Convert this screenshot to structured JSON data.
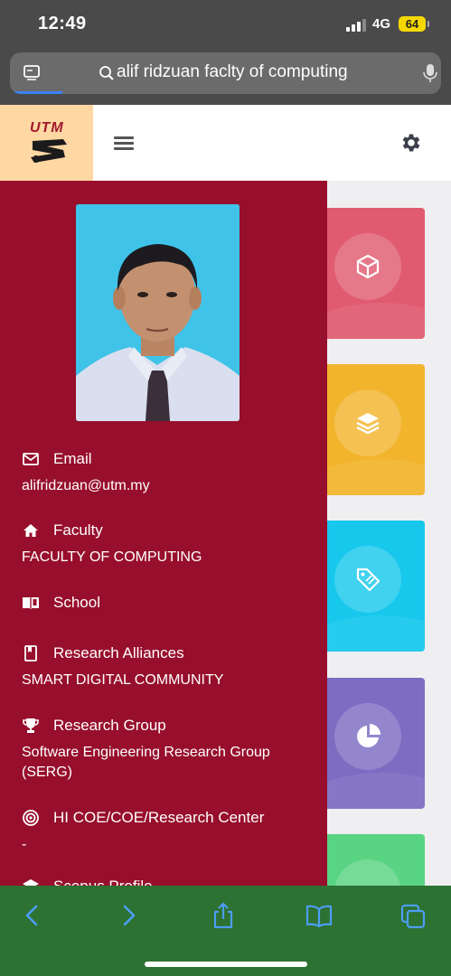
{
  "status_bar": {
    "time": "12:49",
    "network": "4G",
    "battery": "64"
  },
  "url_bar": {
    "text": "alif ridzuan faclty of computing"
  },
  "header": {
    "logo_text": "UTM"
  },
  "profile": {
    "items": [
      {
        "label": "Email",
        "value": "alifridzuan@utm.my",
        "icon": "mail-icon"
      },
      {
        "label": "Faculty",
        "value": "FACULTY OF COMPUTING",
        "icon": "home-icon"
      },
      {
        "label": "School",
        "value": "",
        "icon": "book-icon"
      },
      {
        "label": "Research Alliances",
        "value": "SMART DIGITAL COMMUNITY",
        "icon": "bookmark-icon"
      },
      {
        "label": "Research Group",
        "value": "Software Engineering Research Group (SERG)",
        "icon": "trophy-icon"
      },
      {
        "label": "HI COE/COE/Research Center",
        "value": "-",
        "icon": "target-icon"
      },
      {
        "label": "Scopus Profile",
        "value": "",
        "icon": "profile-icon"
      }
    ]
  },
  "tiles": [
    {
      "color": "#e05b6f",
      "icon": "cube-icon"
    },
    {
      "color": "#f2b42c",
      "icon": "layers-icon"
    },
    {
      "color": "#17c8ec",
      "icon": "tag-icon"
    },
    {
      "color": "#7c6cc2",
      "icon": "pie-chart-icon"
    },
    {
      "color": "#59d482",
      "icon": "chart-icon"
    }
  ],
  "colors": {
    "sidebar": "#970f2c",
    "toolbar": "#2d7133",
    "logo_bg": "#fed7a2"
  }
}
